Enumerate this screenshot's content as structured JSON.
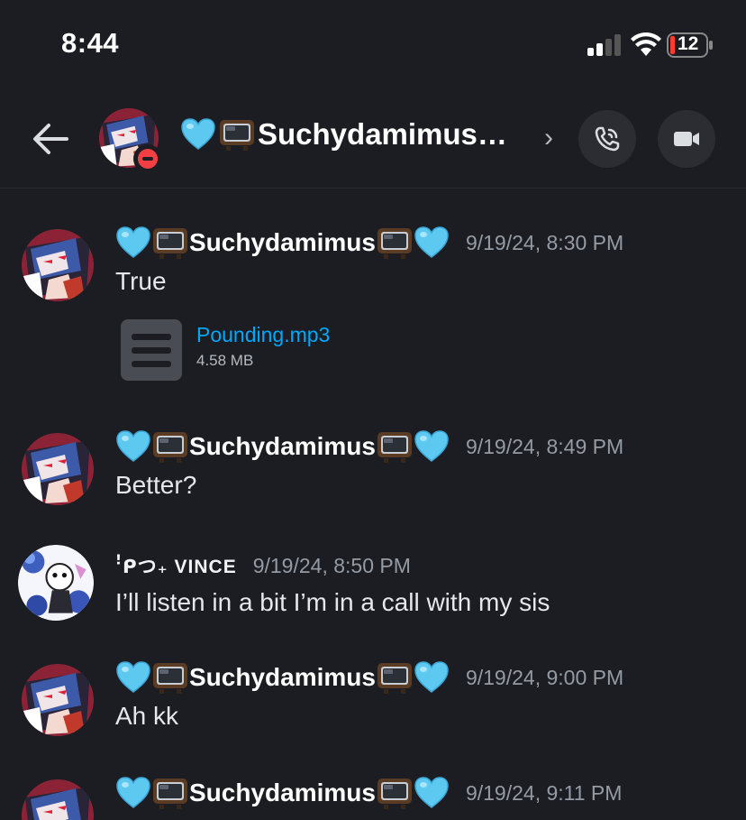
{
  "status_bar": {
    "time": "8:44",
    "battery_level": "12"
  },
  "header": {
    "channel_name": "Suchydamimus…",
    "back_icon": "arrow-left-icon",
    "status": "do-not-disturb",
    "actions": [
      "phone-call-icon",
      "video-camera-icon"
    ]
  },
  "messages": [
    {
      "author": "Suchydamimus",
      "timestamp": "9/19/24, 8:30 PM",
      "text": "True",
      "attachment": {
        "name": "Pounding.mp3",
        "size": "4.58 MB"
      }
    },
    {
      "author": "Suchydamimus",
      "timestamp": "9/19/24, 8:49 PM",
      "text": "Better?"
    },
    {
      "author": "ꜝᑭつ₊ VINCE",
      "timestamp": "9/19/24, 8:50 PM",
      "text": "I’ll listen in a bit I’m in a call with my sis"
    },
    {
      "author": "Suchydamimus",
      "timestamp": "9/19/24, 9:00 PM",
      "text": "Ah kk"
    },
    {
      "author": "Suchydamimus",
      "timestamp": "9/19/24, 9:11 PM",
      "text": ""
    }
  ],
  "colors": {
    "background": "#1c1d22",
    "link": "#00a8fc",
    "timestamp": "#949ba4",
    "dnd": "#f23f43"
  }
}
